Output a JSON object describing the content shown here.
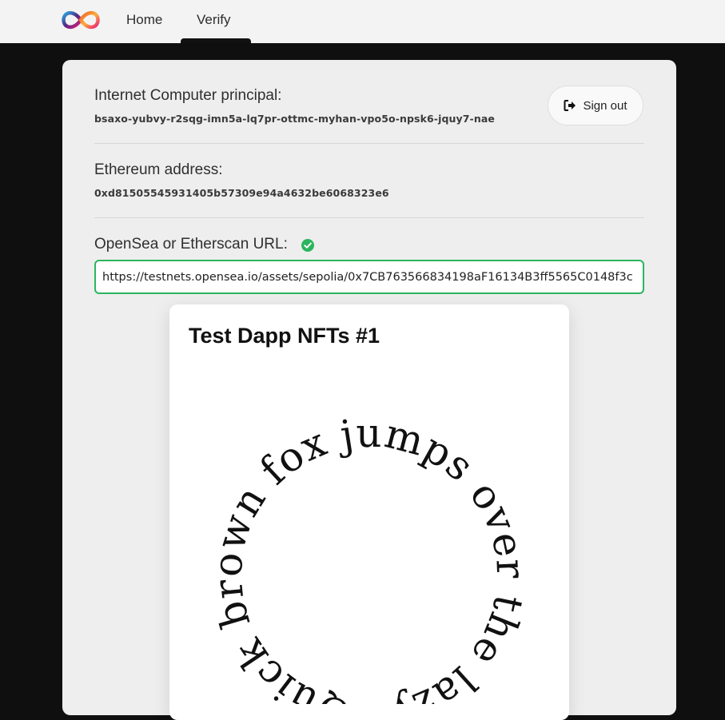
{
  "nav": {
    "logo": "internet-computer-infinity-logo",
    "links": [
      {
        "label": "Home",
        "active": false
      },
      {
        "label": "Verify",
        "active": true
      }
    ]
  },
  "principal": {
    "label": "Internet Computer principal:",
    "value": "bsaxo-yubvy-r2sqg-imn5a-lq7pr-ottmc-myhan-vpo5o-npsk6-jquy7-nae"
  },
  "signout": {
    "label": "Sign out",
    "icon": "sign-out-icon"
  },
  "ethereum": {
    "label": "Ethereum address:",
    "value": "0xd81505545931405b57309e94a4632be6068323e6"
  },
  "url": {
    "label": "OpenSea or Etherscan URL:",
    "status_icon": "check-circle-icon",
    "status_color": "#2bb55e",
    "value": "https://testnets.opensea.io/assets/sepolia/0x7CB763566834198aF16134B3ff5565C0148f3c"
  },
  "nft": {
    "title": "Test Dapp NFTs #1",
    "circle_text": "Quick brown fox jumps over the lazy dog."
  }
}
